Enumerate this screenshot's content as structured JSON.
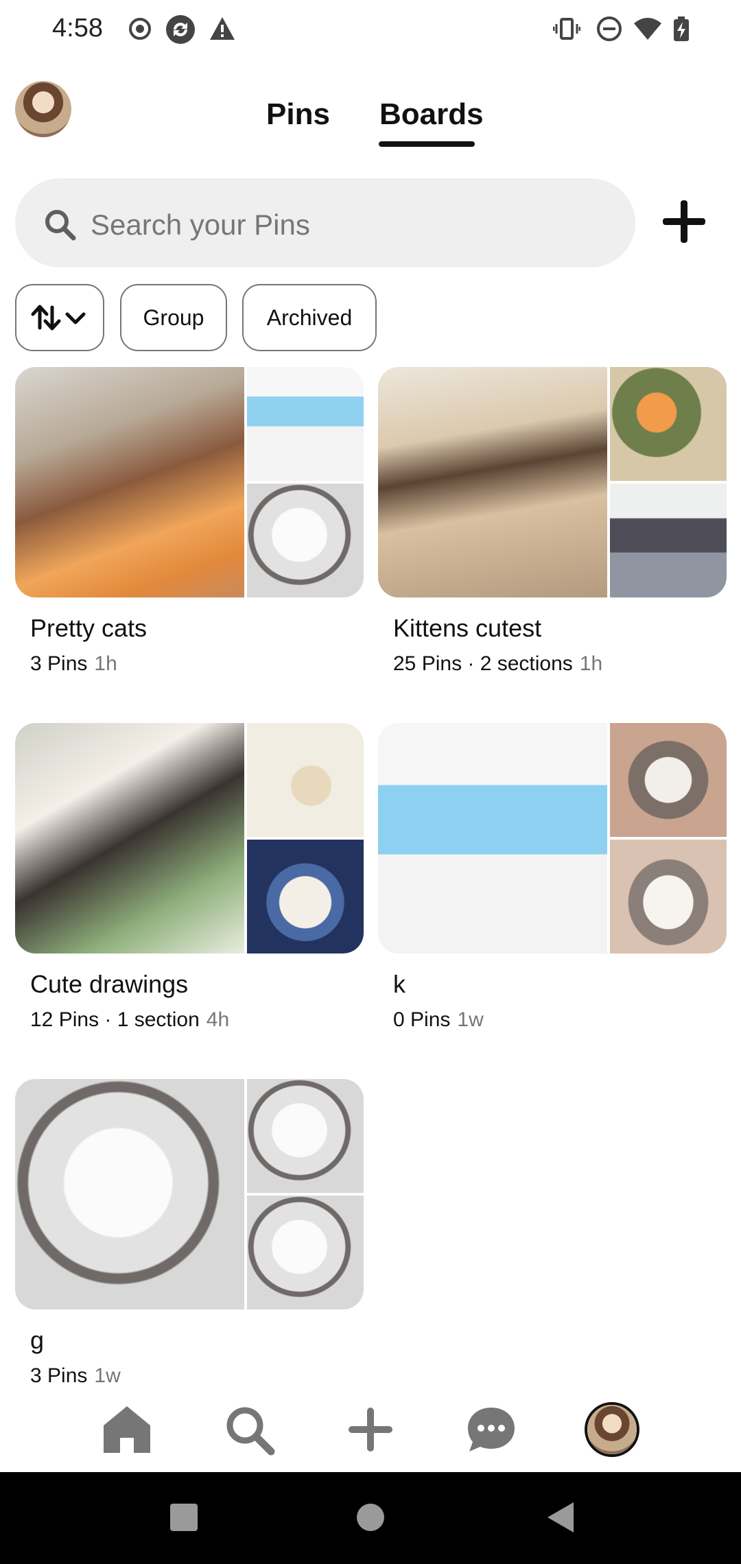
{
  "status_bar": {
    "time": "4:58",
    "left_icons": [
      "record-icon",
      "sync-app-icon",
      "warning-icon"
    ],
    "right_icons": [
      "vibrate-icon",
      "do-not-disturb-icon",
      "wifi-icon",
      "battery-charging-icon"
    ]
  },
  "header": {
    "tabs": [
      {
        "label": "Pins",
        "selected": false
      },
      {
        "label": "Boards",
        "selected": true
      }
    ]
  },
  "search": {
    "placeholder": "Search your Pins"
  },
  "filters": {
    "sort_icon": "sort-arrows-icon",
    "chips": [
      "Group",
      "Archived"
    ]
  },
  "boards": [
    {
      "title": "Pretty cats",
      "meta": "3 Pins",
      "age": "1h"
    },
    {
      "title": "Kittens cutest",
      "meta": "25 Pins · 2 sections",
      "age": "1h"
    },
    {
      "title": "Cute drawings",
      "meta": "12 Pins · 1 section",
      "age": "4h"
    },
    {
      "title": "k",
      "meta": "0 Pins",
      "age": "1w"
    },
    {
      "title": "g",
      "meta": "3 Pins",
      "age": "1w"
    }
  ],
  "bottom_nav": {
    "items": [
      "home-icon",
      "search-icon",
      "create-icon",
      "messages-icon",
      "profile-avatar"
    ]
  },
  "colors": {
    "text": "#111111",
    "secondary_text": "#767676",
    "search_bg": "#efefef",
    "chip_border": "#767676"
  }
}
